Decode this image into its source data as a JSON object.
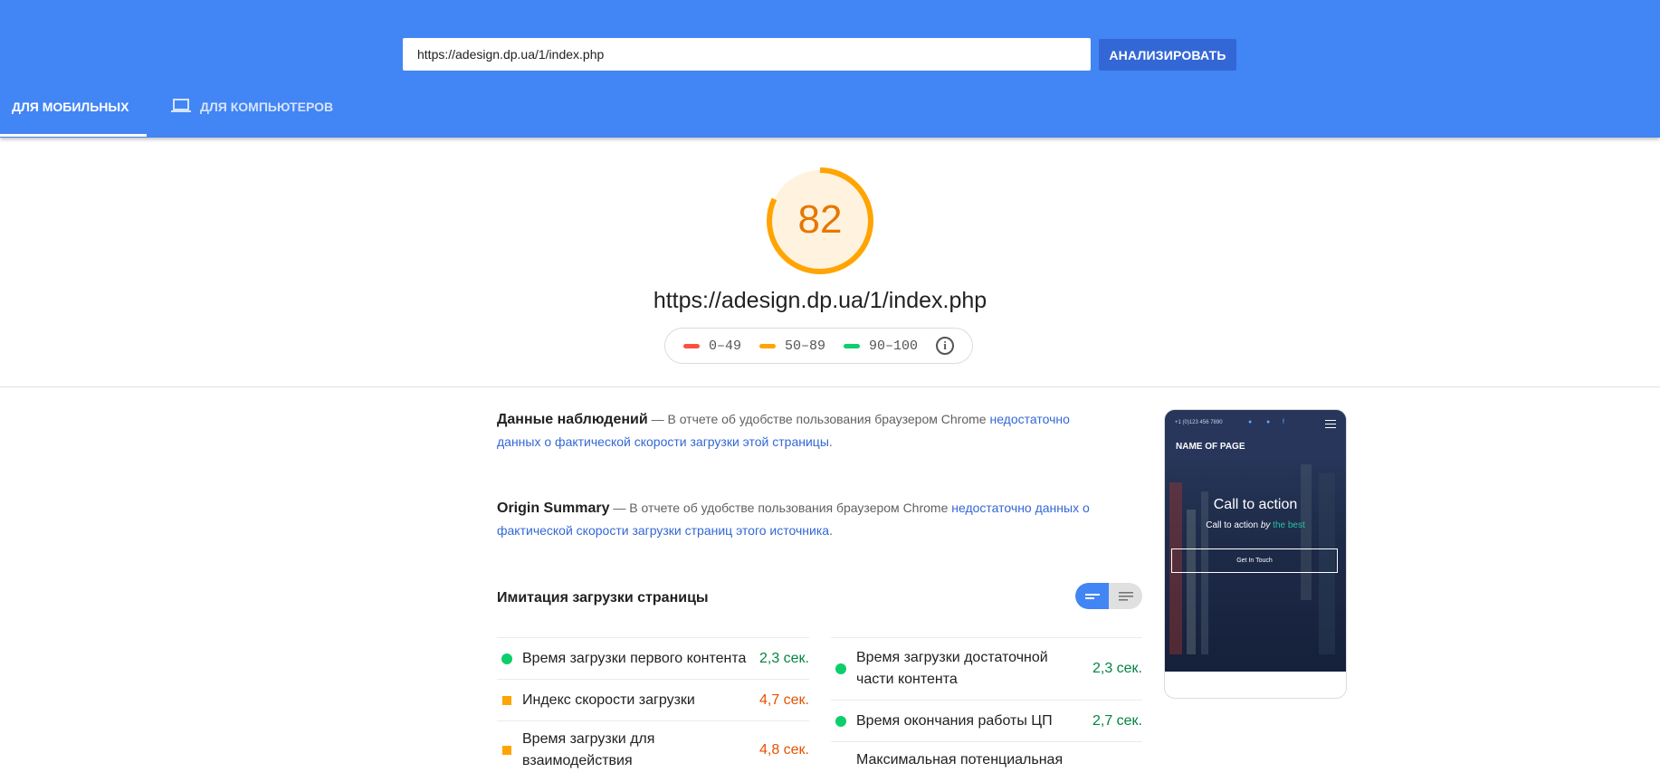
{
  "header": {
    "url_value": "https://adesign.dp.ua/1/index.php",
    "analyze_label": "АНАЛИЗИРОВАТЬ",
    "tabs": [
      {
        "label": "ДЛЯ МОБИЛЬНЫХ",
        "active": true
      },
      {
        "label": "ДЛЯ КОМПЬЮТЕРОВ",
        "active": false,
        "icon": "laptop-icon"
      }
    ],
    "color": "#4285f4"
  },
  "score": {
    "value": "82",
    "fraction": 0.82,
    "color": "#ffa400",
    "url": "https://adesign.dp.ua/1/index.php"
  },
  "legend": {
    "items": [
      {
        "label": "0–49",
        "color": "#ff4e42"
      },
      {
        "label": "50–89",
        "color": "#ffa400"
      },
      {
        "label": "90–100",
        "color": "#0cce6b"
      }
    ],
    "info_icon": "info-icon"
  },
  "field_data": {
    "title": "Данные наблюдений",
    "text": " — В отчете об удобстве пользования браузером Chrome ",
    "link": "недостаточно данных о фактической скорости загрузки этой страницы",
    "end": "."
  },
  "origin_summary": {
    "title": "Origin Summary",
    "text": " — В отчете об удобстве пользования браузером Chrome ",
    "link": "недостаточно данных о фактической скорости загрузки страниц этого источника",
    "end": "."
  },
  "lab": {
    "title": "Имитация загрузки страницы",
    "toggle": [
      "compact-view-icon",
      "detailed-view-icon"
    ],
    "left_metrics": [
      {
        "label": "Время загрузки первого контента",
        "value": "2,3 сек.",
        "status": "pass"
      },
      {
        "label": "Индекс скорости загрузки",
        "value": "4,7 сек.",
        "status": "average"
      },
      {
        "label": "Время загрузки для взаимодействия",
        "value": "4,8 сек.",
        "status": "average"
      }
    ],
    "right_metrics": [
      {
        "label": "Время загрузки достаточной части контента",
        "value": "2,3 сек.",
        "status": "pass"
      },
      {
        "label": "Время окончания работы ЦП",
        "value": "2,7 сек.",
        "status": "pass"
      },
      {
        "label": "Максимальная потенциальная",
        "value": "",
        "status": "pass"
      }
    ]
  },
  "screenshot": {
    "phone_number": "+1 (0)123 456 7890",
    "name_of_page": "NAME OF PAGE",
    "cta_title": "Call to action",
    "cta_sub_1": "Call to action ",
    "cta_sub_em": "by",
    "cta_sub_best": " the best",
    "button": "Get In Touch"
  }
}
